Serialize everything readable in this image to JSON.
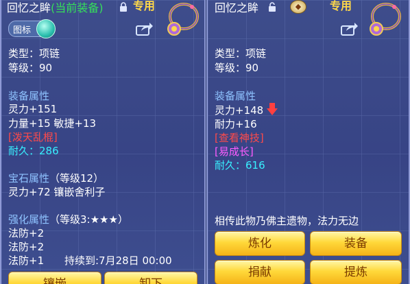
{
  "left": {
    "title": "回忆之眸",
    "status": "(当前装备)",
    "tag": "专用",
    "toggle_label": "图标",
    "type_line": "类型：项链",
    "level_line": "等级：90",
    "equip_attr_header": "装备属性",
    "attr1": "灵力+151",
    "attr2": "力量+15  敏捷+13",
    "special": "[泼天乱棍]",
    "durability_label": "耐久：",
    "durability_value": "286",
    "gem_header": "宝石属性",
    "gem_level": "（等级12）",
    "gem_line": "灵力+72 镶嵌舍利子",
    "forge_header": "强化属性",
    "forge_level": "（等级3:★★★）",
    "forge1": "法防+2",
    "forge2": "法防+2",
    "forge3": "法防+1",
    "forge_duration": "持续到:7月28日 00:00",
    "btn_left": "镶嵌",
    "btn_right": "卸下"
  },
  "right": {
    "title": "回忆之眸",
    "tag": "专用",
    "type_line": "类型：项链",
    "level_line": "等级：90",
    "equip_attr_header": "装备属性",
    "attr1": "灵力+148",
    "attr2": "耐力+16",
    "check_skill": "[查看神技]",
    "grow": "[易成长]",
    "durability_label": "耐久：",
    "durability_value": "616",
    "description": "相传此物乃佛主遗物，法力无边",
    "buttons": [
      "炼化",
      "装备",
      "捐献",
      "提炼"
    ]
  },
  "colors": {
    "current_equip": "#35e05a",
    "header": "#8fc3ff",
    "special": "#ff4a4a",
    "durability": "#38f0ff",
    "grow": "#ff5bff",
    "button": "#ffd83a"
  },
  "icons": {
    "left_lock": "lock-closed-icon",
    "right_lock": "lock-open-icon",
    "share": "share-icon",
    "ornament": "necklace-ornament-icon",
    "compare_down": "arrow-down-icon"
  }
}
